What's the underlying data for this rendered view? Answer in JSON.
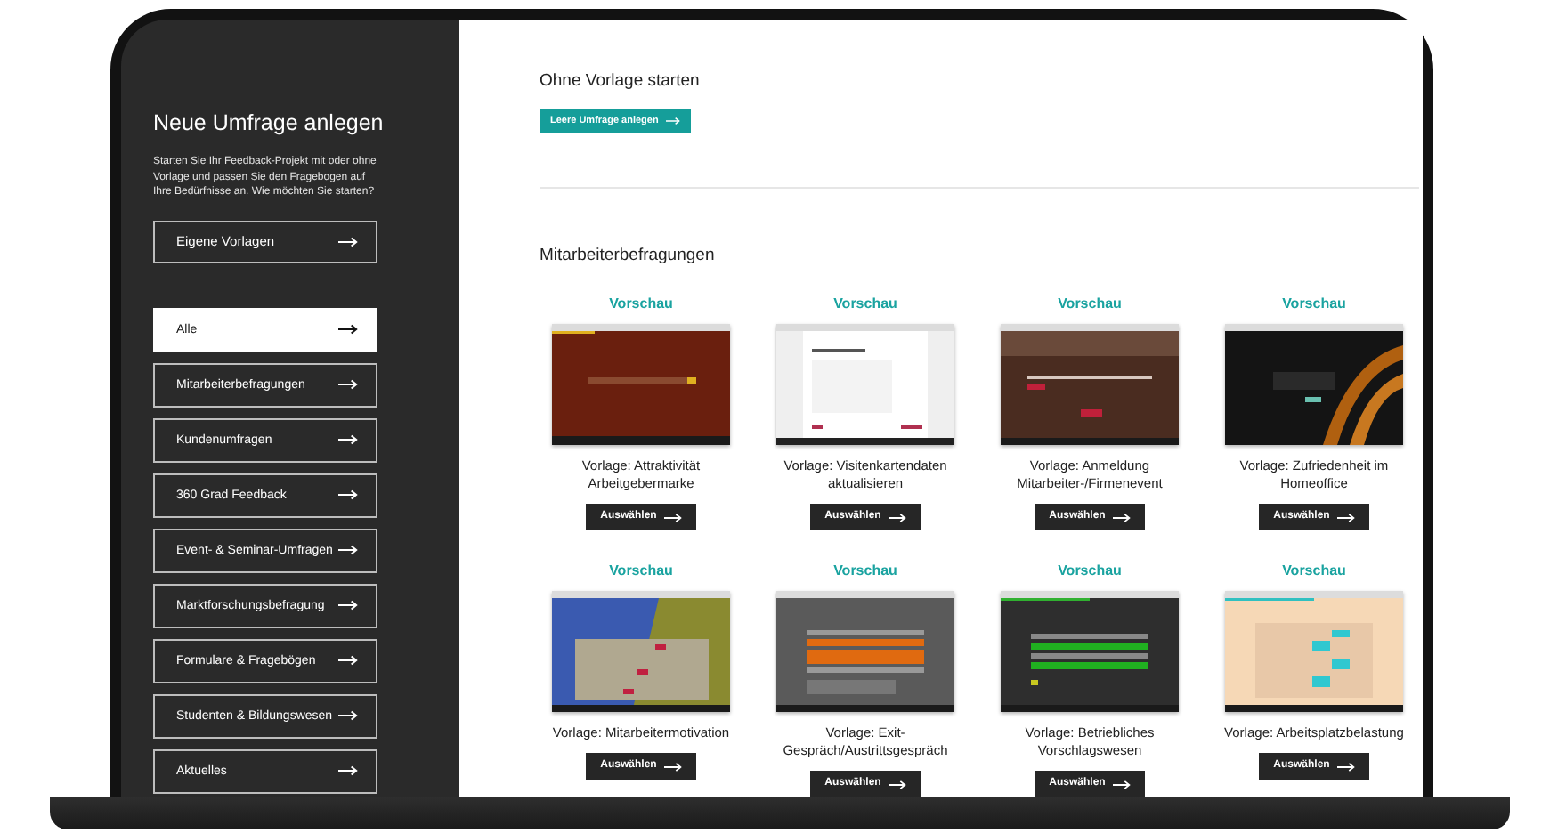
{
  "sidebar": {
    "title": "Neue Umfrage anlegen",
    "intro": "Starten Sie Ihr Feedback-Projekt mit oder ohne Vorlage und passen Sie den Fragebogen auf Ihre Bedürfnisse an. Wie möchten Sie starten?",
    "own_templates": {
      "label": "Eigene Vorlagen"
    },
    "categories": [
      {
        "label": "Alle",
        "selected": true
      },
      {
        "label": "Mitarbeiterbefragungen",
        "selected": false
      },
      {
        "label": "Kundenumfragen",
        "selected": false
      },
      {
        "label": "360 Grad Feedback",
        "selected": false
      },
      {
        "label": "Event- & Seminar-Umfragen",
        "selected": false
      },
      {
        "label": "Marktforschungsbefragung",
        "selected": false
      },
      {
        "label": "Formulare & Fragebögen",
        "selected": false
      },
      {
        "label": "Studenten & Bildungswesen",
        "selected": false
      },
      {
        "label": "Aktuelles",
        "selected": false
      }
    ]
  },
  "blank_start": {
    "title": "Ohne Vorlage starten",
    "button": "Leere Umfrage anlegen"
  },
  "sections": [
    {
      "title": "Mitarbeiterbefragungen",
      "templates": [
        {
          "preview": "Vorschau",
          "title": "Vorlage: Attraktivität Arbeitgebermarke",
          "button": "Auswählen"
        },
        {
          "preview": "Vorschau",
          "title": "Vorlage: Visitenkartendaten aktualisieren",
          "button": "Auswählen"
        },
        {
          "preview": "Vorschau",
          "title": "Vorlage: Anmeldung Mitarbeiter-/Firmenevent",
          "button": "Auswählen"
        },
        {
          "preview": "Vorschau",
          "title": "Vorlage: Zufriedenheit im Homeoffice",
          "button": "Auswählen"
        },
        {
          "preview": "Vorschau",
          "title": "Vorlage: Mitarbeitermotivation",
          "button": "Auswählen"
        },
        {
          "preview": "Vorschau",
          "title": "Vorlage: Exit-Gespräch/Austrittsgespräch",
          "button": "Auswählen"
        },
        {
          "preview": "Vorschau",
          "title": "Vorlage: Betriebliches Vorschlagswesen",
          "button": "Auswählen"
        },
        {
          "preview": "Vorschau",
          "title": "Vorlage: Arbeitsplatzbelastung",
          "button": "Auswählen"
        }
      ]
    }
  ]
}
